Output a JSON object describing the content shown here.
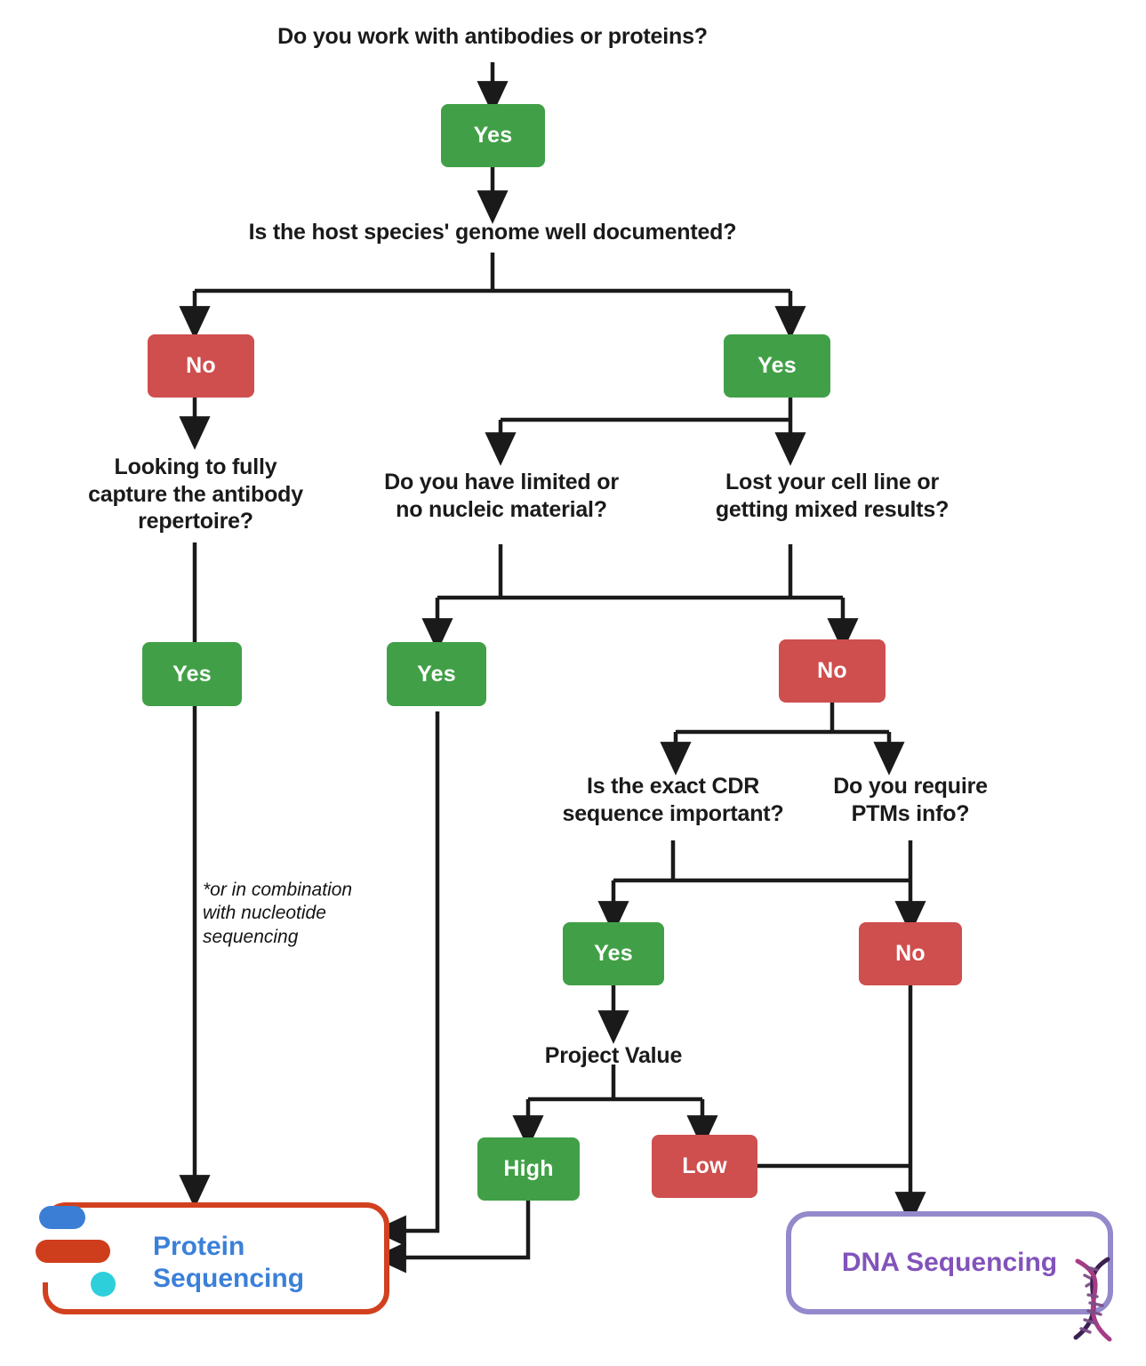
{
  "diagram": {
    "title": "Antibody sequencing decision tree",
    "colors": {
      "yes": "#41a047",
      "no": "#cf4e4e",
      "edge": "#1a1a1a",
      "protein_border": "#d1401f",
      "protein_text": "#3b80d8",
      "dna_border": "#9389cb",
      "dna_text": "#8253ba",
      "logo_blue": "#3a7fd5",
      "logo_red": "#cf3e1c",
      "logo_cyan": "#2dcfda"
    },
    "questions": {
      "q_root": "Do you work with antibodies or proteins?",
      "q_genome": "Is the host species' genome well documented?",
      "q_repertoire": "Looking to fully\ncapture the antibody\nrepertoire?",
      "q_nucleic": "Do you have limited or\nno nucleic material?",
      "q_cellline": "Lost your cell line or\ngetting mixed results?",
      "q_cdr": "Is the exact CDR\nsequence important?",
      "q_ptms": "Do you require\nPTMs info?",
      "q_value": "Project Value"
    },
    "decisions": {
      "d_root_yes": "Yes",
      "d_genome_no": "No",
      "d_genome_yes": "Yes",
      "d_repertoire_yes": "Yes",
      "d_nucleic_yes": "Yes",
      "d_cellline_no": "No",
      "d_cdr_yes": "Yes",
      "d_ptms_no": "No",
      "d_value_high": "High",
      "d_value_low": "Low"
    },
    "note": "*or in combination\nwith nucleotide\nsequencing",
    "terminals": {
      "protein": "Protein\nSequencing",
      "dna": "DNA Sequencing"
    },
    "icons": {
      "protein_logo": "protein-sequencing-logo-icon",
      "dna_helix": "dna-helix-icon"
    }
  }
}
